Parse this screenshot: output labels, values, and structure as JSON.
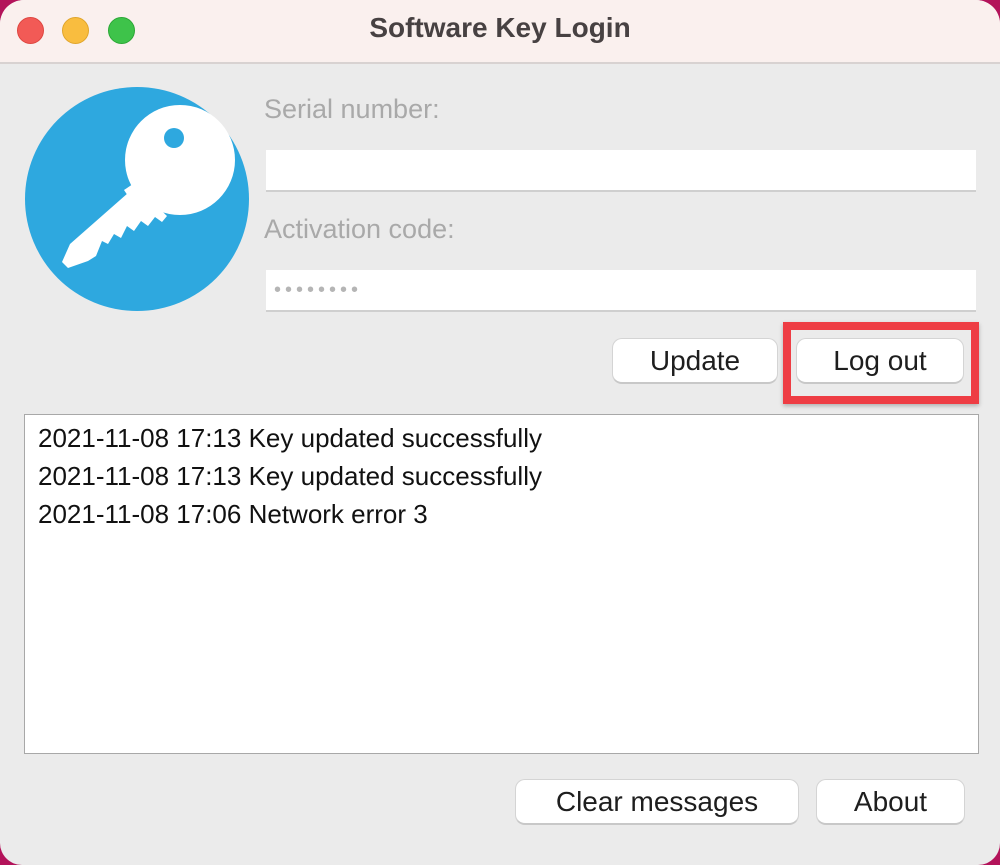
{
  "window": {
    "title": "Software Key Login",
    "traffic_lights": {
      "close": "close-window",
      "minimize": "minimize-window",
      "maximize": "maximize-window"
    }
  },
  "logo": {
    "icon": "key-icon",
    "color": "#2ea8df"
  },
  "form": {
    "serial_label": "Serial number:",
    "serial_value": "",
    "activation_label": "Activation code:",
    "activation_value": "••••••••"
  },
  "buttons": {
    "update": "Update",
    "logout": "Log out",
    "clear_messages": "Clear messages",
    "about": "About"
  },
  "annotation": {
    "highlight_target": "logout",
    "color": "#ee3d44"
  },
  "log": {
    "messages": [
      "2021-11-08 17:13 Key updated successfully",
      "2021-11-08 17:13 Key updated successfully",
      "2021-11-08 17:06 Network error 3"
    ]
  }
}
